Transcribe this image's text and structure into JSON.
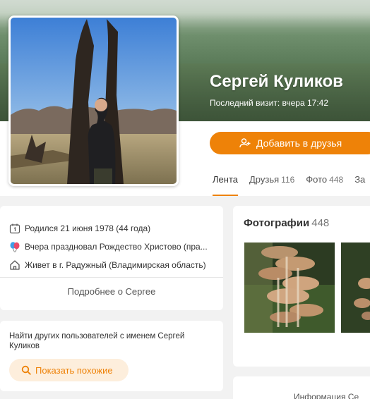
{
  "profile": {
    "name": "Сергей Куликов",
    "last_visit": "Последний визит: вчера 17:42",
    "add_friend_label": "Добавить в друзья"
  },
  "tabs": [
    {
      "label": "Лента",
      "count": "",
      "active": true
    },
    {
      "label": "Друзья",
      "count": "116",
      "active": false
    },
    {
      "label": "Фото",
      "count": "448",
      "active": false
    },
    {
      "label": "За",
      "count": "",
      "active": false
    }
  ],
  "info": {
    "birth": "Родился 21 июня 1978 (44 года)",
    "holiday": "Вчера праздновал Рождество Христово (пра...",
    "location": "Живет в г. Радужный (Владимирская область)",
    "more_link": "Подробнее о Сергее"
  },
  "find_similar": {
    "text": "Найти других пользователей с именем Сергей Куликов",
    "button_label": "Показать похожие"
  },
  "photos": {
    "title": "Фотографии",
    "count": "448"
  },
  "bottom": {
    "label": "Информация Се"
  },
  "colors": {
    "accent": "#ee8208",
    "accent_light": "#fdeedc",
    "card": "#ffffff",
    "background": "#f2f2f2"
  },
  "icons": [
    "add-user-icon",
    "calendar-icon",
    "balloons-icon",
    "house-icon",
    "search-icon"
  ]
}
